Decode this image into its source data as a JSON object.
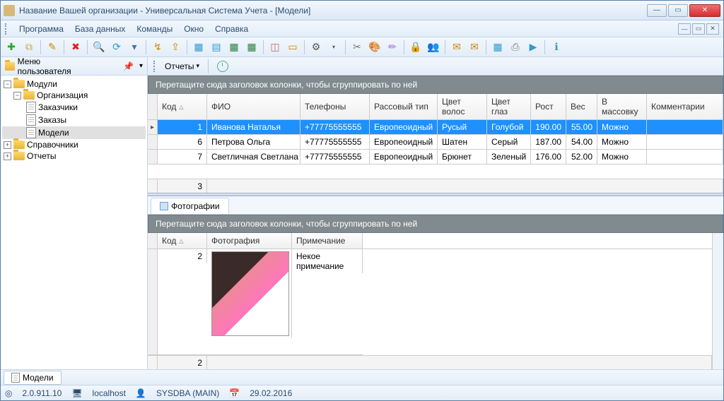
{
  "window": {
    "title": "Название Вашей организации - Универсальная Система Учета - [Модели]"
  },
  "menu": {
    "items": [
      "Программа",
      "База данных",
      "Команды",
      "Окно",
      "Справка"
    ]
  },
  "user_menu": {
    "label": "Меню пользователя"
  },
  "reports": {
    "label": "Отчеты"
  },
  "tree": {
    "root": "Модули",
    "org": "Организация",
    "customers": "Заказчики",
    "orders": "Заказы",
    "models": "Модели",
    "refs": "Справочники",
    "reports": "Отчеты"
  },
  "group_hint": "Перетащите сюда заголовок колонки, чтобы сгруппировать по ней",
  "grid1": {
    "headers": {
      "code": "Код",
      "fio": "ФИО",
      "phones": "Телефоны",
      "race": "Рассовый тип",
      "hair": "Цвет волос",
      "eyes": "Цвет глаз",
      "height": "Рост",
      "weight": "Вес",
      "crowd": "В массовку",
      "comments": "Комментарии"
    },
    "rows": [
      {
        "code": "1",
        "fio": "Иванова Наталья",
        "phones": "+77775555555",
        "race": "Европеоидный",
        "hair": "Русый",
        "eyes": "Голубой",
        "height": "190.00",
        "weight": "55.00",
        "crowd": "Можно",
        "comments": ""
      },
      {
        "code": "6",
        "fio": "Петрова Ольга",
        "phones": "+77775555555",
        "race": "Европеоидный",
        "hair": "Шатен",
        "eyes": "Серый",
        "height": "187.00",
        "weight": "54.00",
        "crowd": "Можно",
        "comments": ""
      },
      {
        "code": "7",
        "fio": "Светличная Светлана",
        "phones": "+77775555555",
        "race": "Европеоидный",
        "hair": "Брюнет",
        "eyes": "Зеленый",
        "height": "176.00",
        "weight": "52.00",
        "crowd": "Можно",
        "comments": ""
      }
    ],
    "footer_count": "3"
  },
  "photos_tab": "Фотографии",
  "grid2": {
    "headers": {
      "code": "Код",
      "photo": "Фотография",
      "note": "Примечание"
    },
    "row": {
      "code": "2",
      "note": "Некое примечание"
    },
    "footer_count": "2"
  },
  "bottom_tab": "Модели",
  "status": {
    "version": "2.0.911.10",
    "host": "localhost",
    "user": "SYSDBA (MAIN)",
    "date": "29.02.2016"
  }
}
